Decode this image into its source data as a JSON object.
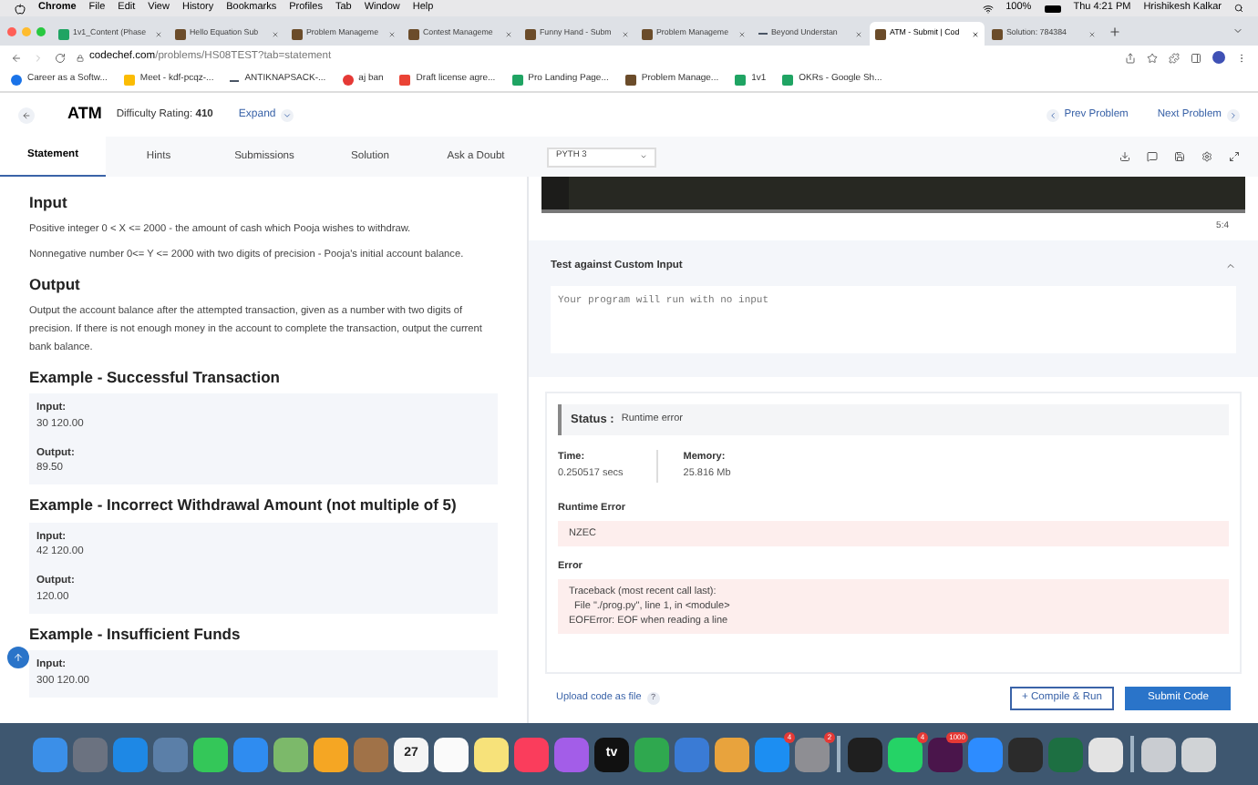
{
  "menu_bar": {
    "app": "Chrome",
    "items": [
      "File",
      "Edit",
      "View",
      "History",
      "Bookmarks",
      "Profiles",
      "Tab",
      "Window",
      "Help"
    ],
    "battery": "100%",
    "clock": "Thu 4:21 PM",
    "user": "Hrishikesh Kalkar"
  },
  "browser_tabs": [
    {
      "title": "1v1_Content (Phase",
      "kind": "sheet",
      "selected": false
    },
    {
      "title": "Hello Equation Sub",
      "kind": "chef",
      "selected": false
    },
    {
      "title": "Problem Manageme",
      "kind": "chef",
      "selected": false
    },
    {
      "title": "Contest Manageme",
      "kind": "chef",
      "selected": false
    },
    {
      "title": "Funny Hand - Subm",
      "kind": "chef",
      "selected": false
    },
    {
      "title": "Problem Manageme",
      "kind": "chef",
      "selected": false
    },
    {
      "title": "Beyond Understan",
      "kind": "dash",
      "selected": false
    },
    {
      "title": "ATM - Submit | Cod",
      "kind": "chef",
      "selected": true
    },
    {
      "title": "Solution: 784384",
      "kind": "chef",
      "selected": false
    }
  ],
  "address": {
    "host": "codechef.com",
    "path": "/problems/HS08TEST?tab=statement"
  },
  "bookmarks": [
    {
      "label": "Career as a Softw...",
      "kind": "person"
    },
    {
      "label": "Meet - kdf-pcqz-...",
      "kind": "meet"
    },
    {
      "label": "ANTIKNAPSACK-...",
      "kind": "dash"
    },
    {
      "label": "aj ban",
      "kind": "stop"
    },
    {
      "label": "Draft license agre...",
      "kind": "mail"
    },
    {
      "label": "Pro Landing Page...",
      "kind": "sheet"
    },
    {
      "label": "Problem Manage...",
      "kind": "chef"
    },
    {
      "label": "1v1",
      "kind": "sheet"
    },
    {
      "label": "OKRs - Google Sh...",
      "kind": "sheet"
    }
  ],
  "problem_header": {
    "title": "ATM",
    "difficulty": "Difficulty Rating: **410**",
    "expand": "Expand",
    "prev": "Prev Problem",
    "next": "Next Problem"
  },
  "tabs": [
    {
      "label": "Statement",
      "selected": true
    },
    {
      "label": "Hints",
      "selected": false
    },
    {
      "label": "Submissions",
      "selected": false
    },
    {
      "label": "Solution",
      "selected": false
    },
    {
      "label": "Ask a Doubt",
      "selected": false
    }
  ],
  "statement": [
    {
      "kind": "heading",
      "text": "Input"
    },
    {
      "kind": "paragraph",
      "text": "Positive integer 0 < X <= 2000 - the amount of cash which Pooja wishes to withdraw."
    },
    {
      "kind": "paragraph",
      "text": "Nonnegative number 0<= Y <= 2000 with two digits of precision - Pooja's initial account balance."
    },
    {
      "kind": "heading",
      "text": "Output"
    },
    {
      "kind": "paragraph",
      "text": "Output the account balance after the attempted transaction, given as a number with two digits of precision. If there is not enough money in the account to complete the transaction, output the current bank balance."
    },
    {
      "kind": "heading",
      "text": "Example - Successful Transaction"
    },
    {
      "kind": "example",
      "input_label": "Input:",
      "input": "30 120.00",
      "output_label": "Output:",
      "output": "89.50"
    },
    {
      "kind": "heading",
      "text": "Example - Incorrect Withdrawal Amount (not multiple of 5)"
    },
    {
      "kind": "example",
      "input_label": "Input:",
      "input": "42 120.00",
      "output_label": "Output:",
      "output": "120.00"
    },
    {
      "kind": "heading",
      "text": "Example - Insufficient Funds"
    },
    {
      "kind": "example",
      "input_label": "Input:",
      "input": "300 120.00"
    }
  ],
  "editor": {
    "language": "PYTH 3",
    "cursor": "5:4"
  },
  "custom_input": {
    "title": "Test against Custom Input",
    "expanded": true,
    "placeholder": "Your program will run with no input"
  },
  "result": {
    "status_label": "Status :",
    "status": "Runtime error",
    "time_label": "Time:",
    "time": "0.250517 secs",
    "memory_label": "Memory:",
    "memory": "25.816 Mb",
    "runtime_error_label": "Runtime Error",
    "runtime_error": "NZEC",
    "error_label": "Error",
    "error_lines": [
      "Traceback (most recent call last):",
      "  File \"./prog.py\", line 1, in <module>",
      "EOFError: EOF when reading a line"
    ]
  },
  "footer": {
    "upload": "Upload code as file",
    "help": "?",
    "compile": "+ Compile & Run",
    "submit": "Submit Code"
  },
  "dock": [
    {
      "color": "#3b8fe8"
    },
    {
      "color": "#6b7280"
    },
    {
      "color": "#1e88e5"
    },
    {
      "color": "#5b7fa8"
    },
    {
      "color": "#34c759"
    },
    {
      "color": "#2f8cf0"
    },
    {
      "color": "#7cb96a"
    },
    {
      "color": "#f5a623"
    },
    {
      "color": "#a07248"
    },
    {
      "color": "#f4f4f4",
      "label": "27"
    },
    {
      "color": "#fafafa"
    },
    {
      "color": "#f7e27a"
    },
    {
      "color": "#fa3d5c"
    },
    {
      "color": "#a35de8"
    },
    {
      "color": "#111111",
      "label": "tv"
    },
    {
      "color": "#2fa84f"
    },
    {
      "color": "#3a7bd5"
    },
    {
      "color": "#e8a33d"
    },
    {
      "color": "#1c8ef2",
      "badge": "4"
    },
    {
      "color": "#8e8e93",
      "badge": "2"
    },
    {
      "color": "#1f1f1f",
      "divider": true
    },
    {
      "color": "#25d366",
      "badge": "4"
    },
    {
      "color": "#4a154b",
      "badge": "1000"
    },
    {
      "color": "#2d8cff"
    },
    {
      "color": "#2b2b2b"
    },
    {
      "color": "#1d6f42"
    },
    {
      "color": "#e3e3e3"
    },
    {
      "color": "#c9ccd1",
      "divider": true
    },
    {
      "color": "#d0d3d6"
    }
  ]
}
